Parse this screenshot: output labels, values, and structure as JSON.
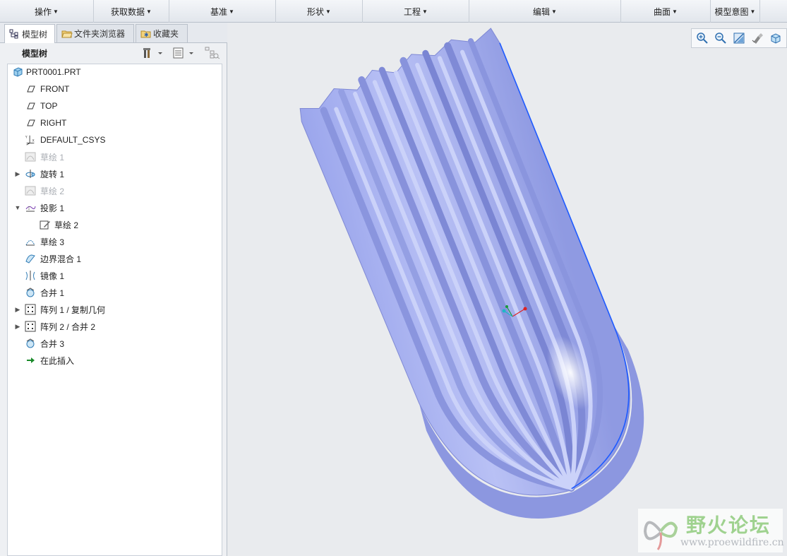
{
  "ribbon": {
    "groups": [
      {
        "label": "操作"
      },
      {
        "label": "获取数据"
      },
      {
        "label": "基准"
      },
      {
        "label": "形状"
      },
      {
        "label": "工程"
      },
      {
        "label": "编辑"
      },
      {
        "label": "曲面"
      },
      {
        "label": "模型意图"
      }
    ]
  },
  "tabs": {
    "model_tree": "模型树",
    "folder_browser": "文件夹浏览器",
    "favorites": "收藏夹"
  },
  "tree_header": {
    "title": "模型树"
  },
  "tree": {
    "items": [
      {
        "label": "PRT0001.PRT",
        "icon": "part-icon"
      },
      {
        "label": "FRONT",
        "icon": "datum-plane-icon"
      },
      {
        "label": "TOP",
        "icon": "datum-plane-icon"
      },
      {
        "label": "RIGHT",
        "icon": "datum-plane-icon"
      },
      {
        "label": "DEFAULT_CSYS",
        "icon": "csys-icon"
      },
      {
        "label": "草绘 1",
        "icon": "sketch-icon",
        "dim": true
      },
      {
        "label": "旋转 1",
        "icon": "revolve-icon",
        "expand": "collapsed"
      },
      {
        "label": "草绘 2",
        "icon": "sketch-icon",
        "dim": true
      },
      {
        "label": "投影 1",
        "icon": "projection-icon",
        "expand": "expanded"
      },
      {
        "label": "草绘 2",
        "icon": "sketch-edit-icon",
        "child": true
      },
      {
        "label": "草绘 3",
        "icon": "sketch-icon"
      },
      {
        "label": "边界混合 1",
        "icon": "boundary-blend-icon"
      },
      {
        "label": "镜像 1",
        "icon": "mirror-icon"
      },
      {
        "label": "合并 1",
        "icon": "merge-icon"
      },
      {
        "label": "阵列 1 / 复制几何",
        "icon": "pattern-icon",
        "expand": "collapsed"
      },
      {
        "label": "阵列 2 / 合并 2",
        "icon": "pattern-icon",
        "expand": "collapsed"
      },
      {
        "label": "合并 3",
        "icon": "merge-icon"
      },
      {
        "label": "在此插入",
        "icon": "insert-here-arrow-icon"
      }
    ]
  },
  "watermark": {
    "title": "野火论坛",
    "url": "www.proewildfire.cn"
  },
  "colors": {
    "model_fill": "#a8b2ef",
    "model_dark": "#8490d6",
    "model_light": "#c6cdf7",
    "edge_highlight": "#1e5bff",
    "tree_bg": "#ffffff",
    "viewport_bg": "#e9ebee"
  }
}
